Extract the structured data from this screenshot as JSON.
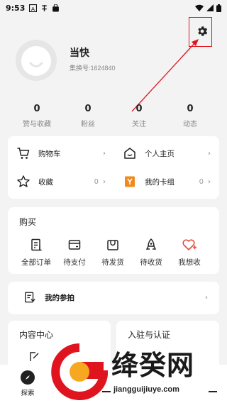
{
  "status_bar": {
    "time": "9:53",
    "left_icons": [
      "a-icon",
      "chinese-char-icon",
      "shopping-bag-icon"
    ],
    "right_icons": [
      "wifi-icon",
      "signal-icon",
      "battery-icon"
    ]
  },
  "profile": {
    "name": "当快",
    "id_text": "集换号:1624840"
  },
  "stats": [
    {
      "value": "0",
      "label": "赞与收藏"
    },
    {
      "value": "0",
      "label": "粉丝"
    },
    {
      "value": "0",
      "label": "关注"
    },
    {
      "value": "0",
      "label": "动态"
    }
  ],
  "quick_links": [
    {
      "label": "购物车",
      "icon": "cart-icon",
      "count": ""
    },
    {
      "label": "个人主页",
      "icon": "home-icon",
      "count": ""
    },
    {
      "label": "收藏",
      "icon": "star-icon",
      "count": "0"
    },
    {
      "label": "我的卡组",
      "icon": "card-deck-icon",
      "count": "0"
    }
  ],
  "purchase": {
    "title": "购买",
    "items": [
      {
        "label": "全部订单",
        "icon": "orders-icon"
      },
      {
        "label": "待支付",
        "icon": "wallet-icon"
      },
      {
        "label": "待发货",
        "icon": "package-icon"
      },
      {
        "label": "待收货",
        "icon": "rocket-icon"
      },
      {
        "label": "我想收",
        "icon": "heart-plus-icon"
      }
    ]
  },
  "auction": {
    "label": "我的参拍"
  },
  "content_center": {
    "title": "内容中心"
  },
  "certification": {
    "title": "入驻与认证"
  },
  "bottom_nav": {
    "explore_label": "探索"
  },
  "watermark": {
    "title": "绛癸网",
    "url": "jiangguijiuye.com"
  },
  "colors": {
    "accent_red": "#e0141e",
    "orange": "#f08a1c",
    "heart_red": "#e84a3c"
  }
}
